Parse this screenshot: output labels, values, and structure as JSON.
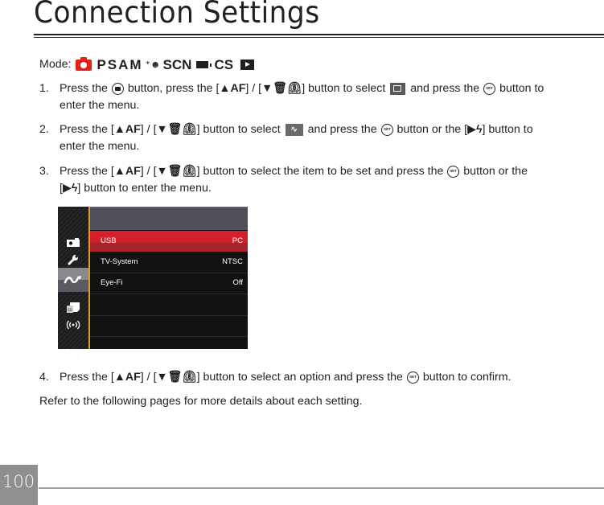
{
  "page": {
    "title": "Connection Settings",
    "page_number": "100"
  },
  "mode": {
    "label": "Mode:",
    "icons": [
      "auto-camera-icon",
      "PSAM",
      "beauty-icon",
      "SCN",
      "movie-icon",
      "CS",
      "playback-icon"
    ],
    "psam": "PSAM",
    "scn": "SCN",
    "cs": "CS",
    "beauty_glyph": "✦"
  },
  "buttons": {
    "up_af": "▲AF",
    "down_del_timer": "▼🗑⏲",
    "right_flash": "▶ϟ",
    "set": "SET"
  },
  "steps": [
    {
      "num": "1.",
      "parts": [
        "Press the",
        "button, press the [",
        "] / [",
        "] button to select",
        "and press the",
        "button to",
        "enter the menu."
      ]
    },
    {
      "num": "2.",
      "parts": [
        "Press the [",
        "] / [",
        "] button to select",
        "and press the",
        "button or the [",
        "] button to",
        "enter the menu."
      ]
    },
    {
      "num": "3.",
      "parts": [
        "Press the [",
        "] / [",
        "] button to select the item to be set and press the",
        "button or the",
        "[",
        "] button to enter the menu."
      ]
    },
    {
      "num": "4.",
      "parts": [
        "Press the [",
        "] / [",
        "] button to select an option and press the",
        "button to confirm."
      ]
    }
  ],
  "refer_text": "Refer to the following pages for more details about each setting.",
  "camera_screen": {
    "sidebar": [
      {
        "icon": "camera-settings-icon",
        "active": false
      },
      {
        "icon": "wrench-icon",
        "active": false
      },
      {
        "icon": "connection-icon",
        "active": true
      },
      {
        "icon": "sd-card-icon",
        "active": false
      },
      {
        "icon": "wireless-icon",
        "active": false
      }
    ],
    "rows": [
      {
        "label": "USB",
        "value": "PC",
        "selected": true
      },
      {
        "label": "TV-System",
        "value": "NTSC",
        "selected": false
      },
      {
        "label": "Eye-Fi",
        "value": "Off",
        "selected": false
      },
      {
        "label": "",
        "value": "",
        "selected": false
      },
      {
        "label": "",
        "value": "",
        "selected": false
      }
    ],
    "colors": {
      "header": "#4e4f58",
      "selected": "#d4202a",
      "separator": "#e39a2c",
      "background": "#111111"
    }
  }
}
